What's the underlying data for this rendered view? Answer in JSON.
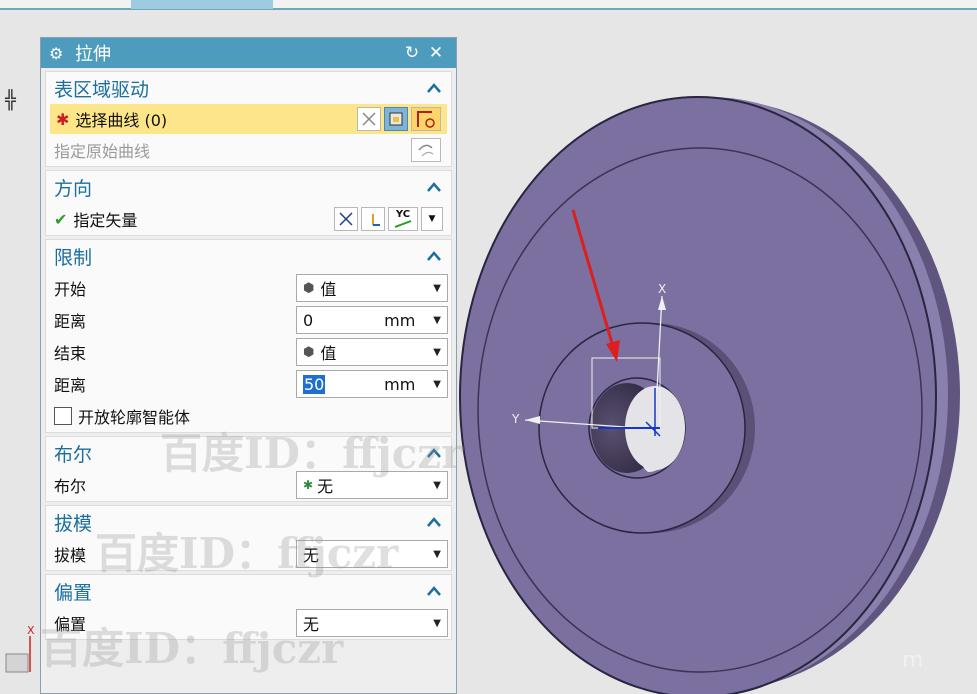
{
  "dialog": {
    "title": "拉伸"
  },
  "sections": {
    "surface_region": {
      "header": "表区域驱动",
      "select_curve_label": "选择曲线 (0)",
      "specify_original_curve_label": "指定原始曲线"
    },
    "direction": {
      "header": "方向",
      "specify_vector_label": "指定矢量",
      "vector_button_label": "YC"
    },
    "limits": {
      "header": "限制",
      "start_label": "开始",
      "start_value": "值",
      "start_distance_label": "距离",
      "start_distance_value": "0",
      "start_distance_unit": "mm",
      "end_label": "结束",
      "end_value": "值",
      "end_distance_label": "距离",
      "end_distance_value": "50",
      "end_distance_unit": "mm",
      "open_profile_label": "开放轮廓智能体"
    },
    "boolean": {
      "header": "布尔",
      "label": "布尔",
      "value": "无"
    },
    "draft": {
      "header": "拔模",
      "label": "拔模",
      "value": "无"
    },
    "offset": {
      "header": "偏置",
      "label": "偏置",
      "value": "无"
    }
  },
  "viewport": {
    "axis_x_label": "X",
    "axis_y_label": "Y",
    "triad_x_label": "X"
  },
  "watermark": {
    "text": "百度ID：ffjczr",
    "corner_text": "m"
  },
  "colors": {
    "titlebar": "#4d9cbd",
    "section_header": "#1b6f9f",
    "selection_highlight": "#fde58a",
    "part_face": "#7b70a0",
    "arrow": "#dd1e1e"
  }
}
